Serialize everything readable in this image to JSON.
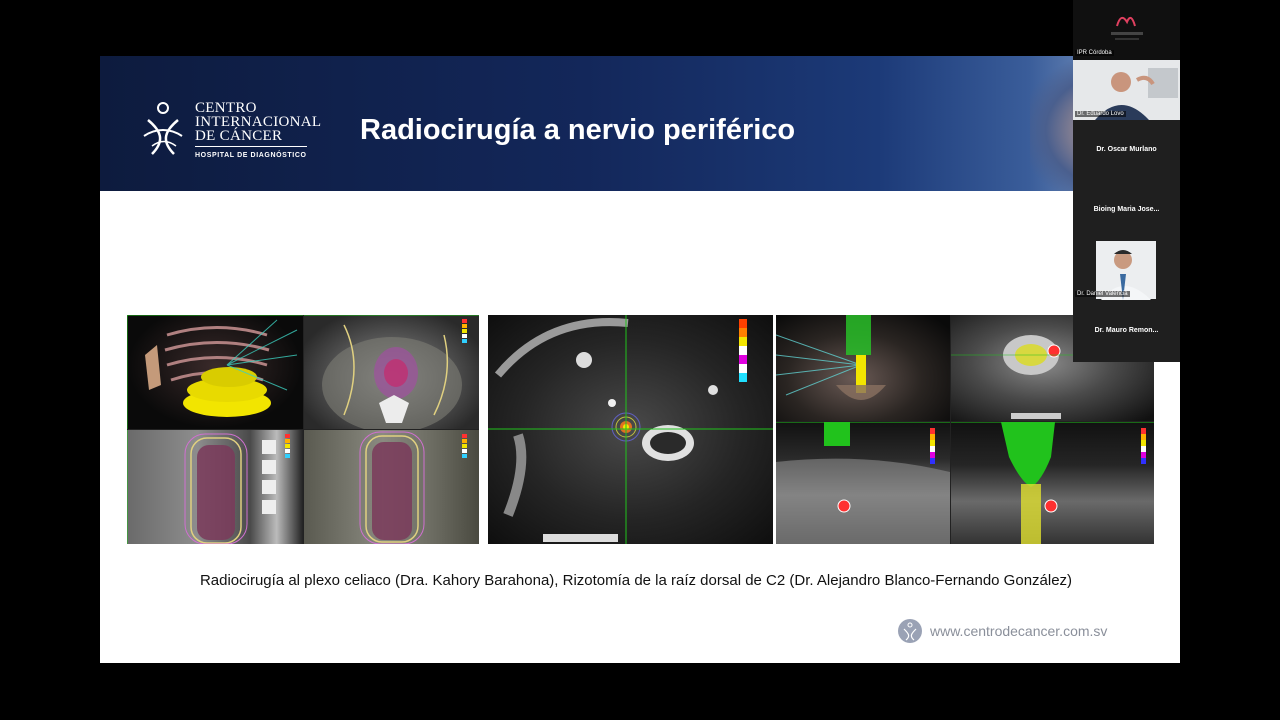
{
  "slide": {
    "brand_line1": "CENTRO",
    "brand_line2": "INTERNACIONAL",
    "brand_line3": "DE CÁNCER",
    "brand_sub": "HOSPITAL DE DIAGNÓSTICO",
    "title": "Radiocirugía a nervio periférico",
    "caption": "Radiocirugía al plexo celiaco (Dra. Kahory Barahona), Rizotomía de la raíz dorsal de C2 (Dr. Alejandro Blanco-Fernando González)",
    "website": "www.centrodecancer.com.sv"
  },
  "participants": [
    {
      "name": "IPR Córdoba",
      "type": "logo"
    },
    {
      "name": "Dr. Eduardo Lovo",
      "type": "video"
    },
    {
      "name": "Dr. Oscar Murlano",
      "type": "name"
    },
    {
      "name": "Bioing Maria Jose...",
      "type": "name"
    },
    {
      "name": "Dr. Daniel Valencia",
      "type": "photo"
    },
    {
      "name": "Dr. Mauro Remon...",
      "type": "name"
    }
  ],
  "colors": {
    "banner": "#0d1b3e",
    "dose_yellow": "#f2e500",
    "contour_green": "#21c21c"
  }
}
